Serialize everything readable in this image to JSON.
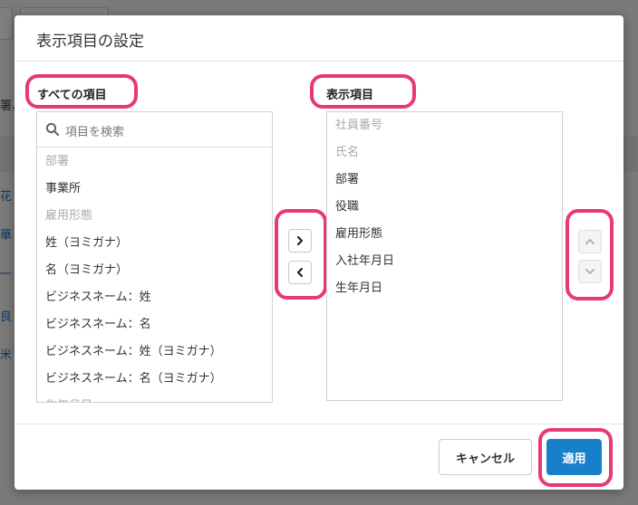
{
  "dialog": {
    "title": "表示項目の設定",
    "cancel_label": "キャンセル",
    "apply_label": "適用"
  },
  "available": {
    "label": "すべての項目",
    "search_placeholder": "項目を検索",
    "items": [
      {
        "label": "部署",
        "muted": true
      },
      {
        "label": "事業所",
        "muted": false
      },
      {
        "label": "雇用形態",
        "muted": true
      },
      {
        "label": "姓（ヨミガナ）",
        "muted": false
      },
      {
        "label": "名（ヨミガナ）",
        "muted": false
      },
      {
        "label": "ビジネスネーム：姓",
        "muted": false
      },
      {
        "label": "ビジネスネーム：名",
        "muted": false
      },
      {
        "label": "ビジネスネーム：姓（ヨミガナ）",
        "muted": false
      },
      {
        "label": "ビジネスネーム：名（ヨミガナ）",
        "muted": false
      },
      {
        "label": "生年月日",
        "muted": true
      }
    ]
  },
  "selected": {
    "label": "表示項目",
    "items": [
      {
        "label": "社員番号",
        "muted": true
      },
      {
        "label": "氏名",
        "muted": true
      },
      {
        "label": "部署",
        "muted": false
      },
      {
        "label": "役職",
        "muted": false
      },
      {
        "label": "雇用形態",
        "muted": false
      },
      {
        "label": "入社年月日",
        "muted": false
      },
      {
        "label": "生年月日",
        "muted": false
      }
    ]
  },
  "background": {
    "row_fragments": [
      "署、",
      "花",
      "華",
      "一",
      "良",
      "米"
    ]
  },
  "colors": {
    "highlight": "#e8377a",
    "primary": "#1780c8",
    "link": "#1a73c9"
  }
}
